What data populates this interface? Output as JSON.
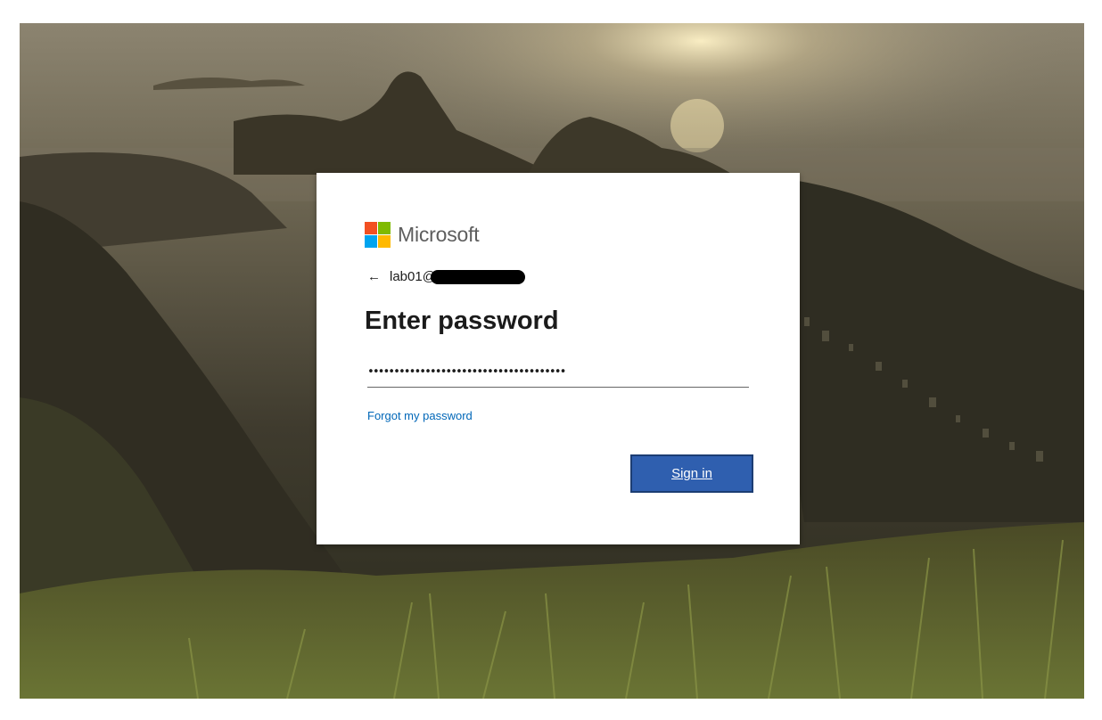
{
  "brand": {
    "name": "Microsoft",
    "logo_colors": [
      "#f25022",
      "#7fba00",
      "#00a4ef",
      "#ffb900"
    ]
  },
  "identity": {
    "back_icon": "←",
    "username_visible": "lab01@"
  },
  "form": {
    "title": "Enter password",
    "password_value": "••••••••••••••••••••••••••••••••••••••",
    "forgot_link": "Forgot my password",
    "signin_label": "Sign in"
  },
  "colors": {
    "accent": "#2f5faf",
    "link": "#0067b8",
    "card_bg": "#ffffff"
  }
}
